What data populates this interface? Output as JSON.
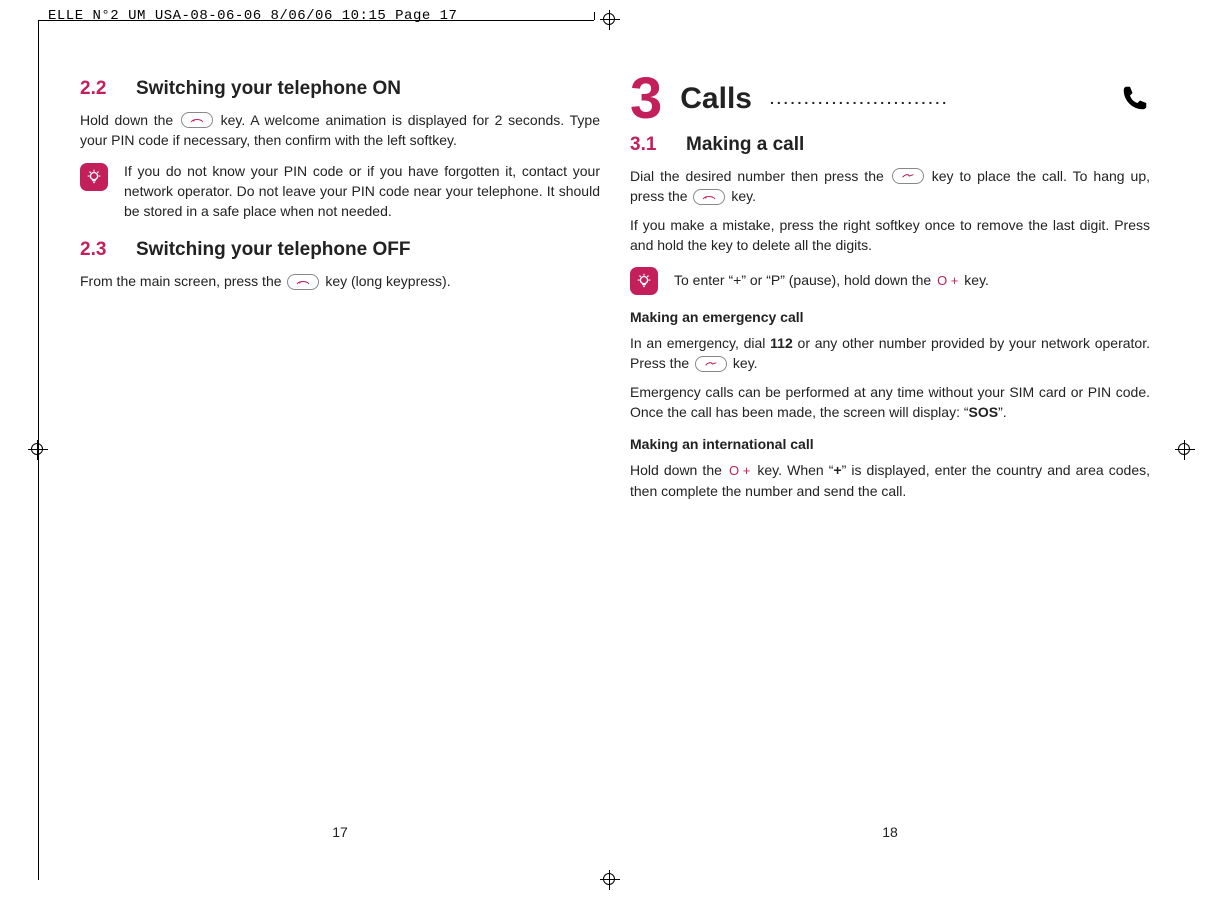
{
  "slug": "ELLE_N°2_UM_USA-08-06-06  8/06/06  10:15  Page 17",
  "left": {
    "s22_num": "2.2",
    "s22_title": "Switching your telephone ON",
    "s22_p1a": "Hold down the ",
    "s22_p1b": " key. A welcome animation is displayed for 2 seconds. Type your PIN code if necessary, then confirm with the left softkey.",
    "tip": "If you do not know your PIN code or if you have forgotten it, contact your network operator. Do not leave your PIN code near your telephone. It should be stored in a safe place when not needed.",
    "s23_num": "2.3",
    "s23_title": "Switching your telephone OFF",
    "s23_p1a": "From the main screen, press the ",
    "s23_p1b": " key (long keypress).",
    "folio": "17"
  },
  "right": {
    "chapter_num": "3",
    "chapter_title": "Calls",
    "s31_num": "3.1",
    "s31_title": "Making a call",
    "p1a": "Dial the desired number then press the ",
    "p1b": " key to place the call. To hang up, press the ",
    "p1c": " key.",
    "p2": "If you make a mistake, press the right softkey once to remove the last digit. Press and hold the key to delete all the digits.",
    "tip_a": "To enter “+” or “P” (pause), hold down the ",
    "tip_b": " key.",
    "okey": "O +",
    "sub_emerg": "Making an emergency call",
    "emerg_a": "In an emergency, dial ",
    "emerg_num": "112",
    "emerg_b": " or any other number provided by your network operator. Press the ",
    "emerg_c": " key.",
    "emerg2a": "Emergency calls can be performed at any time without your SIM card or PIN code. Once the call has been made, the screen will display: “",
    "emerg2b": "SOS",
    "emerg2c": "”.",
    "sub_intl": "Making an international call",
    "intl_a": "Hold down the ",
    "intl_b": " key. When “",
    "intl_plus": "+",
    "intl_c": "” is displayed, enter the country and area codes, then complete the number and send the call.",
    "folio": "18"
  }
}
